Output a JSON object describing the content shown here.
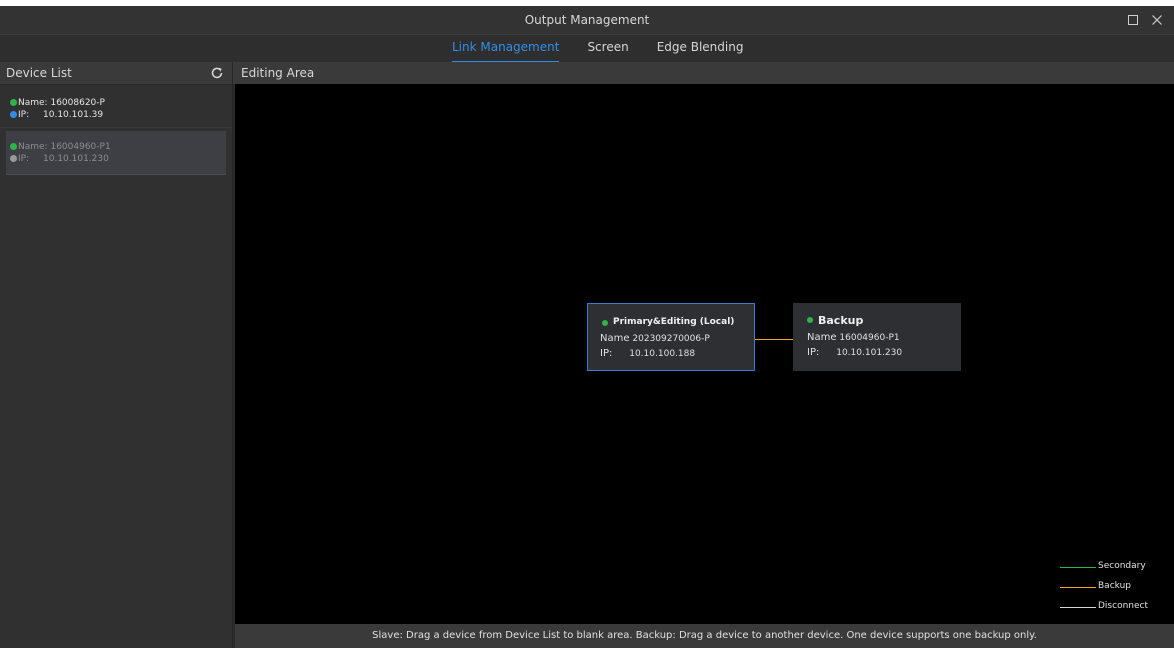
{
  "window": {
    "title": "Output Management"
  },
  "tabs": [
    {
      "label": "Link Management",
      "active": true
    },
    {
      "label": "Screen",
      "active": false
    },
    {
      "label": "Edge Blending",
      "active": false
    }
  ],
  "device_list": {
    "header": "Device List",
    "refresh_icon": "refresh-icon",
    "devices": [
      {
        "name_label": "Name:",
        "name": "16008620-P",
        "ip_label": "IP:",
        "ip": "10.10.101.39",
        "name_dot": "#2fb44a",
        "ip_dot": "#2f8fe8"
      },
      {
        "name_label": "Name:",
        "name": "16004960-P1",
        "ip_label": "IP:",
        "ip": "10.10.101.230",
        "name_dot": "#2fb44a",
        "ip_dot": "#9a9a9a"
      }
    ]
  },
  "editing_area": {
    "header": "Editing Area",
    "primary": {
      "title": "Primary&Editing (Local)",
      "name_label": "Name",
      "name": "202309270006-P",
      "ip_label": "IP:",
      "ip": "10.10.100.188"
    },
    "backup": {
      "title": "Backup",
      "name_label": "Name",
      "name": "16004960-P1",
      "ip_label": "IP:",
      "ip": "10.10.101.230"
    },
    "legend": [
      {
        "label": "Secondary",
        "color": "#2fb44a"
      },
      {
        "label": "Backup",
        "color": "#f0a62a"
      },
      {
        "label": "Disconnect",
        "color": "#d8d8d8"
      }
    ]
  },
  "status": "Slave: Drag a device from Device List to blank area. Backup: Drag a device to another device. One device supports one backup only.",
  "colors": {
    "accent": "#2f8fe8",
    "online": "#2fb44a",
    "backup_link": "#f0a62a"
  }
}
